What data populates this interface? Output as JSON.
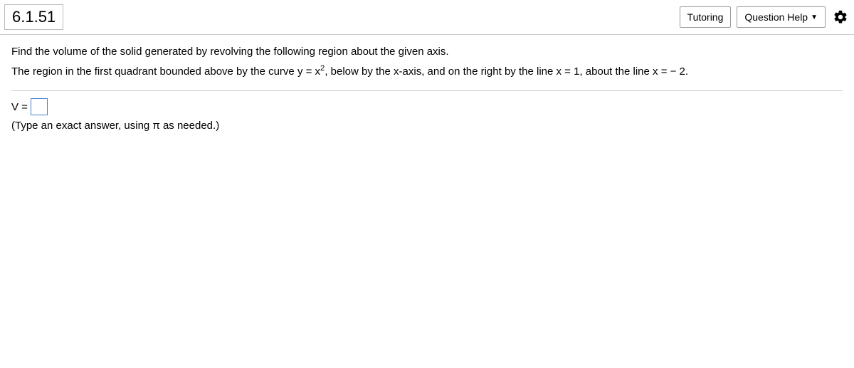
{
  "header": {
    "question_number": "6.1.51",
    "tutoring_label": "Tutoring",
    "help_label": "Question Help"
  },
  "problem": {
    "line1": "Find the volume of the solid generated by revolving the following region about the given axis.",
    "line2_a": "The region in the first quadrant bounded above by the curve ",
    "line2_eq1": "y = x",
    "line2_exp": "2",
    "line2_b": ", below by the x-axis, and on the right by the line ",
    "line2_eq2": "x = 1",
    "line2_c": ", about the line ",
    "line2_eq3": "x = − 2",
    "line2_d": "."
  },
  "answer": {
    "label": "V =",
    "value": "",
    "hint": "(Type an exact answer, using π as needed.)"
  }
}
